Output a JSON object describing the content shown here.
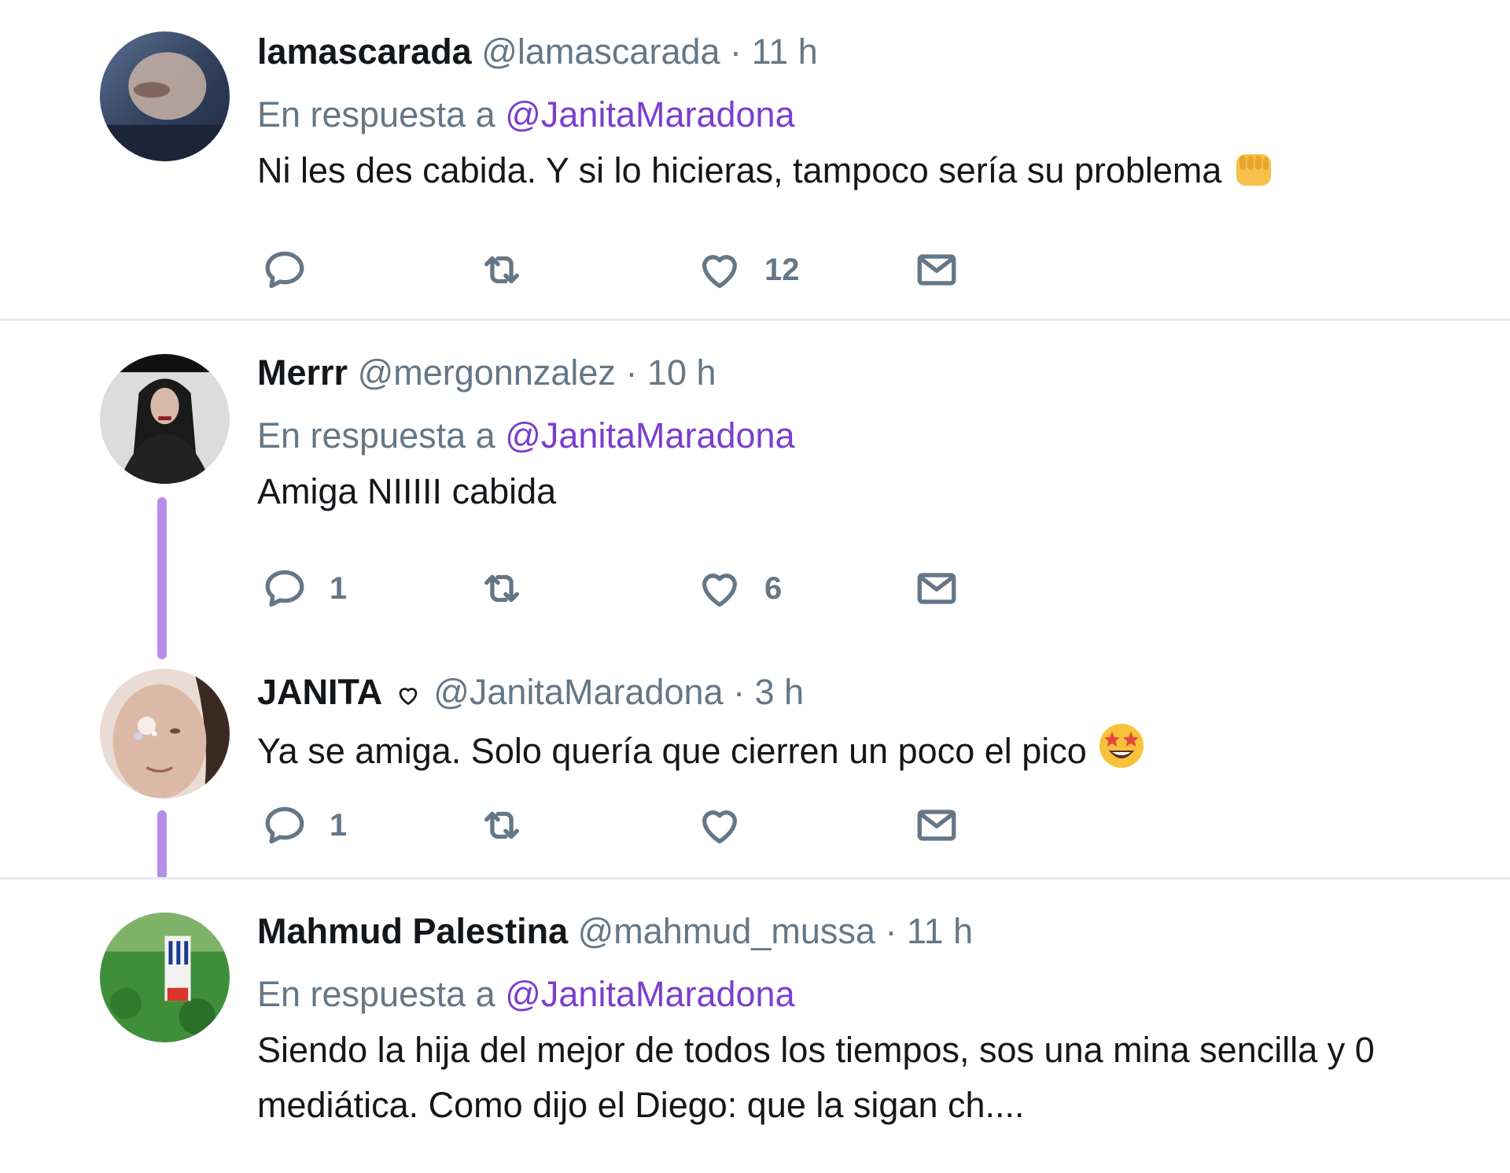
{
  "colors": {
    "accent": "#7a3ed1",
    "muted": "#657786",
    "thread": "#b68ee8",
    "text": "#14171a"
  },
  "tweets": [
    {
      "name": "lamascarada",
      "handle": "@lamascarada",
      "sep": "·",
      "time": "11 h",
      "reply_prefix": "En respuesta a",
      "reply_to": "@JanitaMaradona",
      "text": "Ni les des cabida. Y si lo hicieras, tampoco sería su problema",
      "emoji": "fist-icon",
      "replies": "",
      "retweets": "",
      "likes": "12"
    },
    {
      "name": "Merrr",
      "handle": "@mergonnzalez",
      "sep": "·",
      "time": "10 h",
      "reply_prefix": "En respuesta a",
      "reply_to": "@JanitaMaradona",
      "text": "Amiga NIIIII cabida",
      "replies": "1",
      "retweets": "",
      "likes": "6"
    },
    {
      "name": "JANITA",
      "name_badge": "heart-outline-icon",
      "handle": "@JanitaMaradona",
      "sep": "·",
      "time": "3 h",
      "text": "Ya se amiga. Solo quería que cierren un poco el pico",
      "emoji": "star-struck-icon",
      "replies": "1",
      "retweets": "",
      "likes": ""
    },
    {
      "name": "Mahmud Palestina",
      "handle": "@mahmud_mussa",
      "sep": "·",
      "time": "11 h",
      "reply_prefix": "En respuesta a",
      "reply_to": "@JanitaMaradona",
      "text_line1": "Siendo la hija del mejor de todos los tiempos, sos una mina sencilla y 0",
      "text_line2": "mediática. Como dijo el Diego: que la sigan ch...."
    }
  ]
}
